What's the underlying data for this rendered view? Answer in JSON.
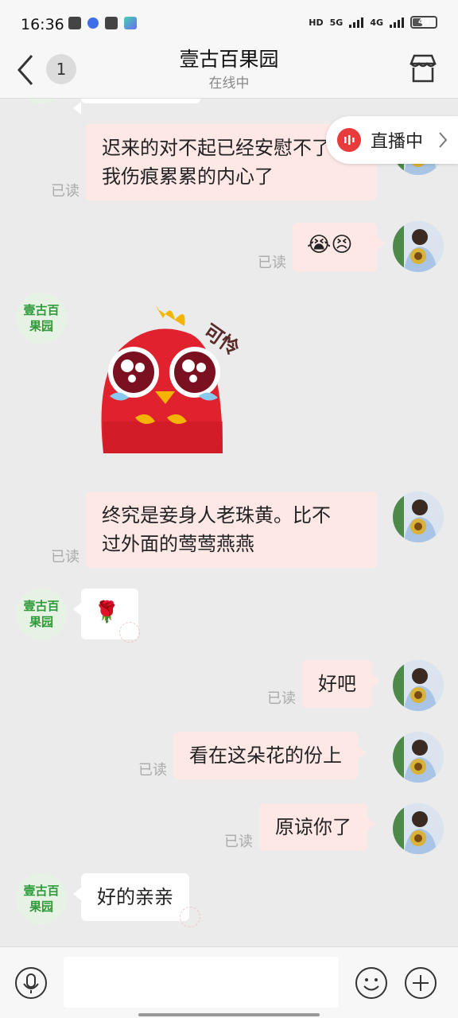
{
  "status": {
    "time": "16:36",
    "hd": "HD",
    "net1": "5G",
    "net2": "4G",
    "battery": "48"
  },
  "header": {
    "back_icon": "chevron-left-icon",
    "unread_count": "1",
    "title": "壹古百果园",
    "subtitle": "在线中",
    "shop_icon": "store-icon"
  },
  "live": {
    "label": "直播中",
    "icon": "live-icon"
  },
  "shop_avatar_text": "壹古百\n果园",
  "read_label": "已读",
  "messages": [
    {
      "dir": "out",
      "type": "text",
      "text": "迟来的对不起已经安慰不了\n我伤痕累累的内心了",
      "read": "已读"
    },
    {
      "dir": "out",
      "type": "emoji",
      "text": "😭😣",
      "read": "已读"
    },
    {
      "dir": "in",
      "type": "sticker",
      "sticker_caption": "可怜"
    },
    {
      "dir": "out",
      "type": "text",
      "text": "终究是妾身人老珠黄。比不\n过外面的莺莺燕燕",
      "read": "已读"
    },
    {
      "dir": "in",
      "type": "emoji",
      "text": "🌹"
    },
    {
      "dir": "out",
      "type": "text",
      "text": "好吧",
      "read": "已读"
    },
    {
      "dir": "out",
      "type": "text",
      "text": "看在这朵花的份上",
      "read": "已读"
    },
    {
      "dir": "out",
      "type": "text",
      "text": "原谅你了",
      "read": "已读"
    },
    {
      "dir": "in",
      "type": "text",
      "text": "好的亲亲"
    }
  ],
  "bottom": {
    "voice_icon": "microphone-icon",
    "emoji_icon": "smiley-icon",
    "plus_icon": "plus-icon",
    "input_placeholder": ""
  }
}
